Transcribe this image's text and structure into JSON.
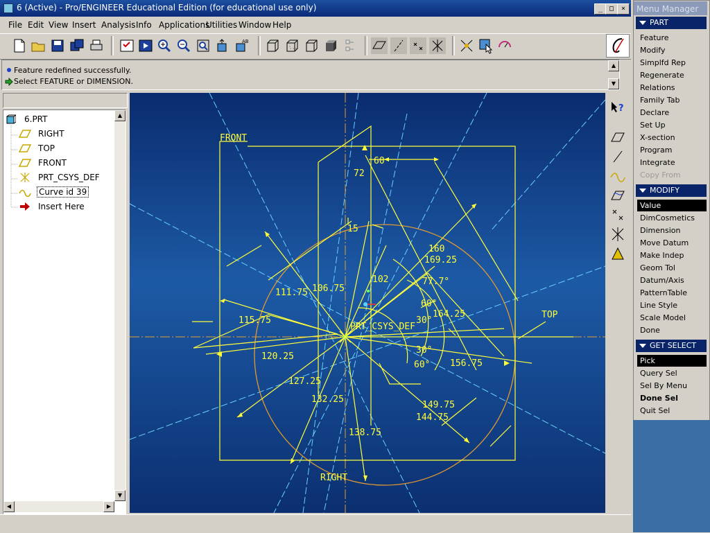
{
  "window": {
    "title": "6 (Active) - Pro/ENGINEER Educational Edition (for educational use only)"
  },
  "menus": [
    "File",
    "Edit",
    "View",
    "Insert",
    "Analysis",
    "Info",
    "Applications",
    "Utilities",
    "Window",
    "Help"
  ],
  "messages": {
    "line1": "Feature redefined successfully.",
    "line2": "Select FEATURE or DIMENSION."
  },
  "tree": {
    "root": "6.PRT",
    "items": [
      "RIGHT",
      "TOP",
      "FRONT",
      "PRT_CSYS_DEF",
      "Curve id 39",
      "Insert Here"
    ]
  },
  "menu_manager": {
    "title": "Menu Manager",
    "part": {
      "header": "PART",
      "items": [
        "Feature",
        "Modify",
        "Simplfd Rep",
        "Regenerate",
        "Relations",
        "Family Tab",
        "Declare",
        "Set Up",
        "X-section",
        "Program",
        "Integrate",
        "Copy From"
      ]
    },
    "modify": {
      "header": "MODIFY",
      "items": [
        "Value",
        "DimCosmetics",
        "Dimension",
        "Move Datum",
        "Make Indep",
        "Geom Tol",
        "Datum/Axis",
        "PatternTable",
        "Line Style",
        "Scale Model",
        "Done"
      ]
    },
    "get_select": {
      "header": "GET SELECT",
      "items": [
        "Pick",
        "Query Sel",
        "Sel By Menu",
        "Done Sel",
        "Quit Sel"
      ]
    }
  },
  "sketch": {
    "datum_labels": {
      "front": "FRONT",
      "top": "TOP",
      "right": "RIGHT",
      "csys": "PRT_CSYS_DEF"
    },
    "dimensions": [
      "60",
      "72",
      "15",
      "160",
      "169.25",
      "102",
      "77.7°",
      "106.75",
      "111.75",
      "60°",
      "30°",
      "164.25",
      "115.75",
      "120.25",
      "30°",
      "60°",
      "156.75",
      "127.25",
      "132.25",
      "149.75",
      "144.75",
      "138.75"
    ]
  },
  "colors": {
    "titlebar": "#0a246a",
    "viewport": "#1d5aa6",
    "sketch": "#ffff3a",
    "circle": "#e0a030",
    "axis": "#6ad0ff"
  }
}
